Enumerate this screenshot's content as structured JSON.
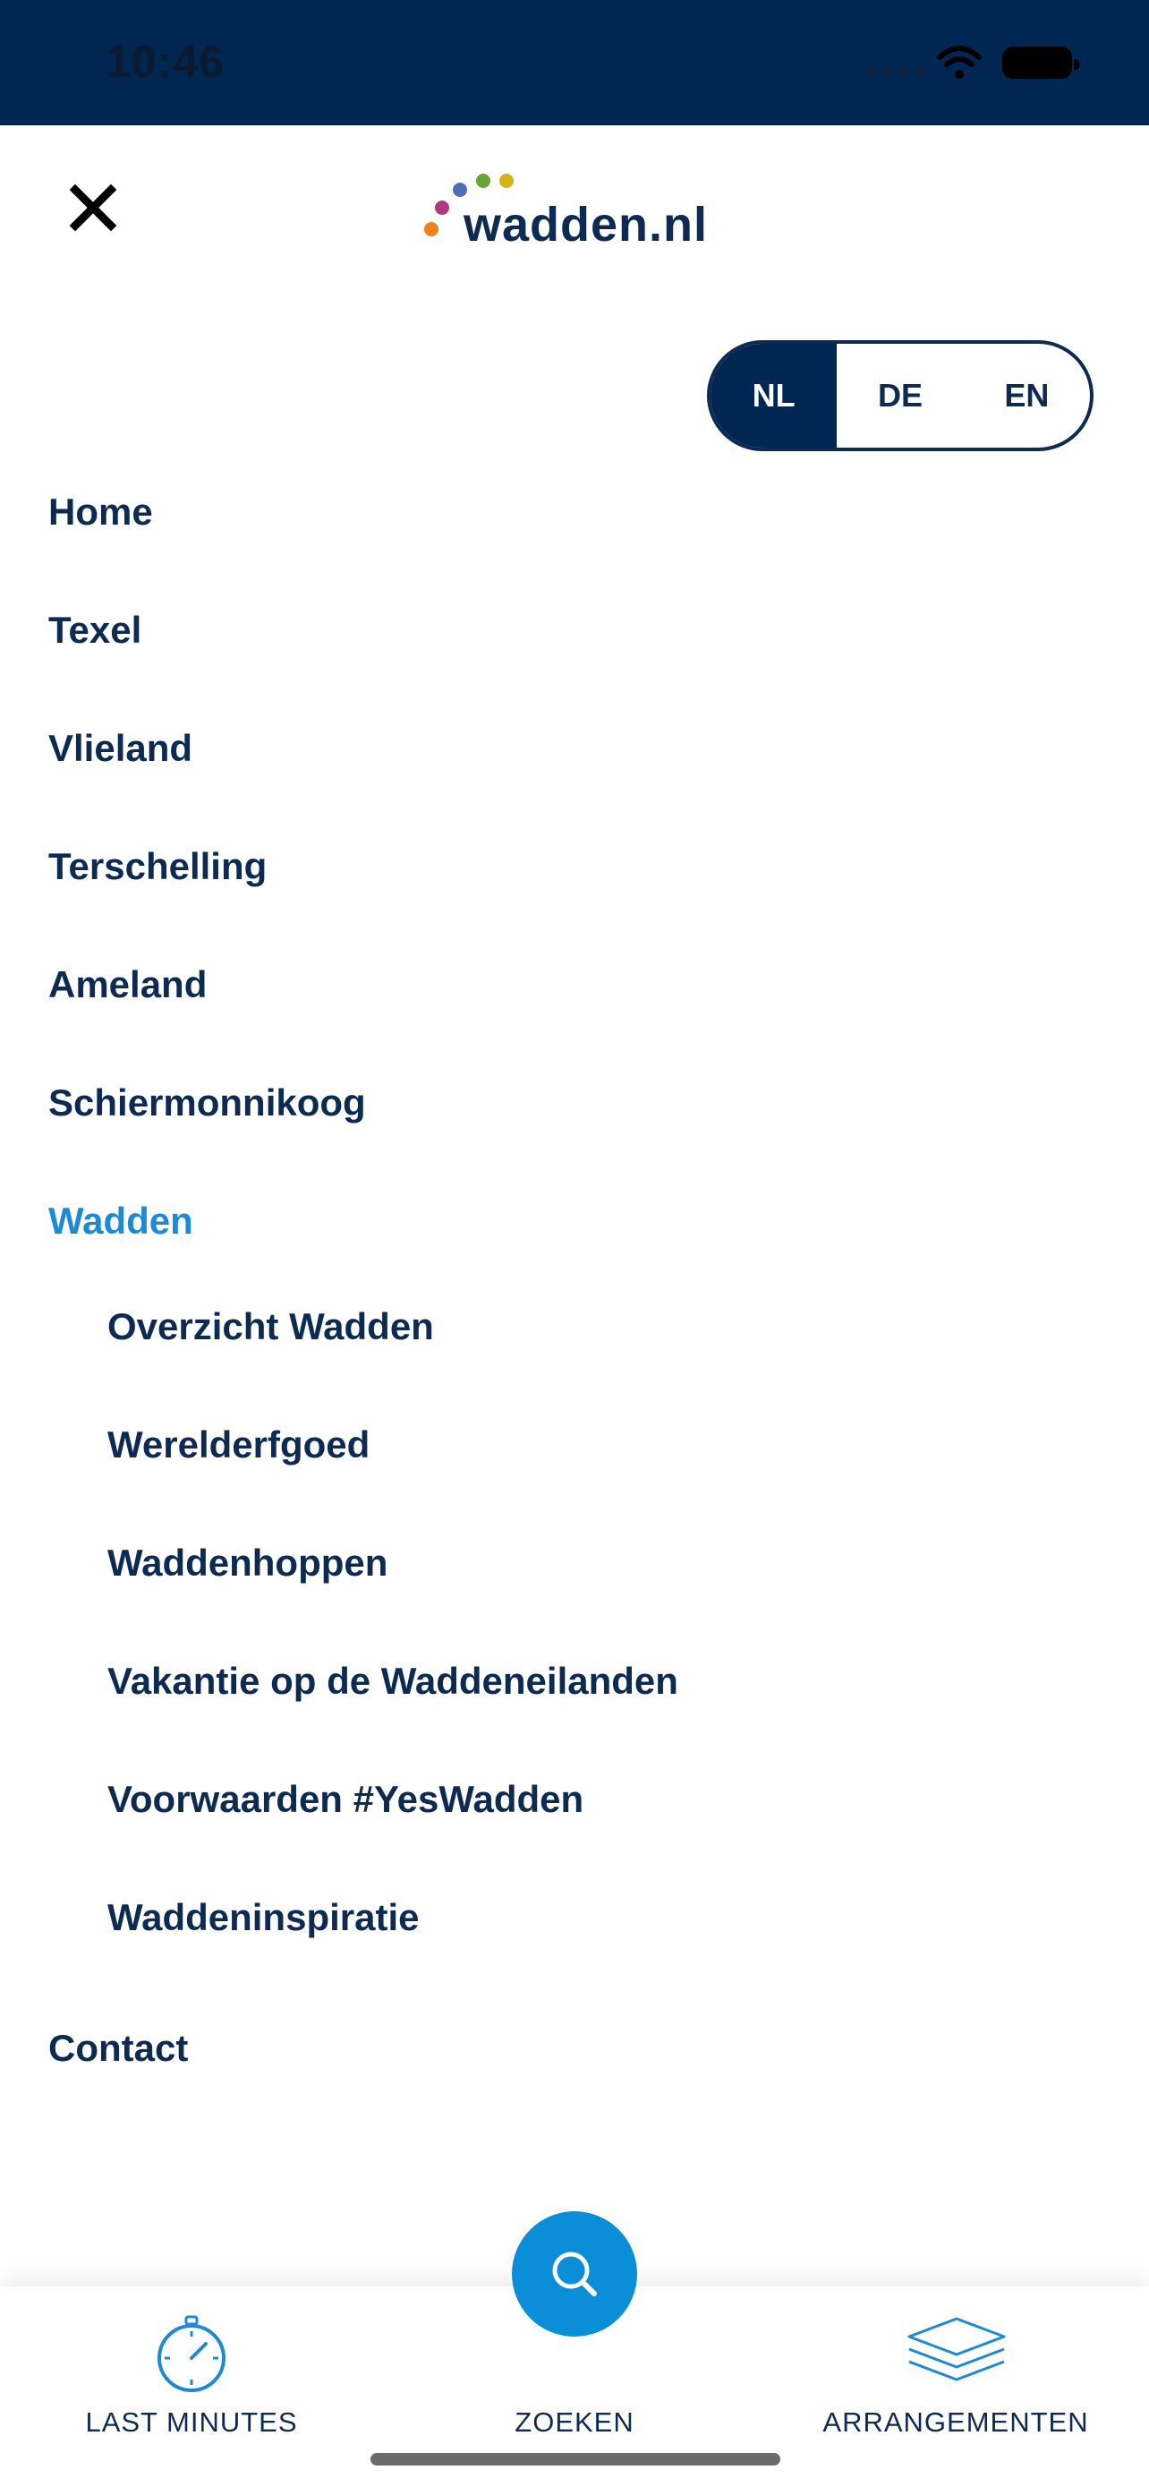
{
  "status_bar": {
    "time": "10:46"
  },
  "header": {
    "logo_text": "wadden.nl"
  },
  "language": {
    "options": [
      "NL",
      "DE",
      "EN"
    ],
    "selected": "NL"
  },
  "menu": {
    "items": [
      "Home",
      "Texel",
      "Vlieland",
      "Terschelling",
      "Ameland",
      "Schiermonnikoog",
      "Wadden",
      "Contact"
    ],
    "active": "Wadden",
    "submenu": [
      "Overzicht Wadden",
      "Werelderfgoed",
      "Waddenhoppen",
      "Vakantie op de Waddeneilanden",
      "Voorwaarden #YesWadden",
      "Waddeninspiratie"
    ]
  },
  "tabbar": {
    "last_minutes": "LAST MINUTES",
    "zoeken": "ZOEKEN",
    "arrangementen": "ARRANGEMENTEN"
  },
  "colors": {
    "navy": "#002652",
    "text": "#0d2a52",
    "accent": "#1c8ad4",
    "search_button": "#0b8ed8"
  },
  "icons": [
    "close-icon",
    "stopwatch-icon",
    "search-icon",
    "layers-icon"
  ]
}
